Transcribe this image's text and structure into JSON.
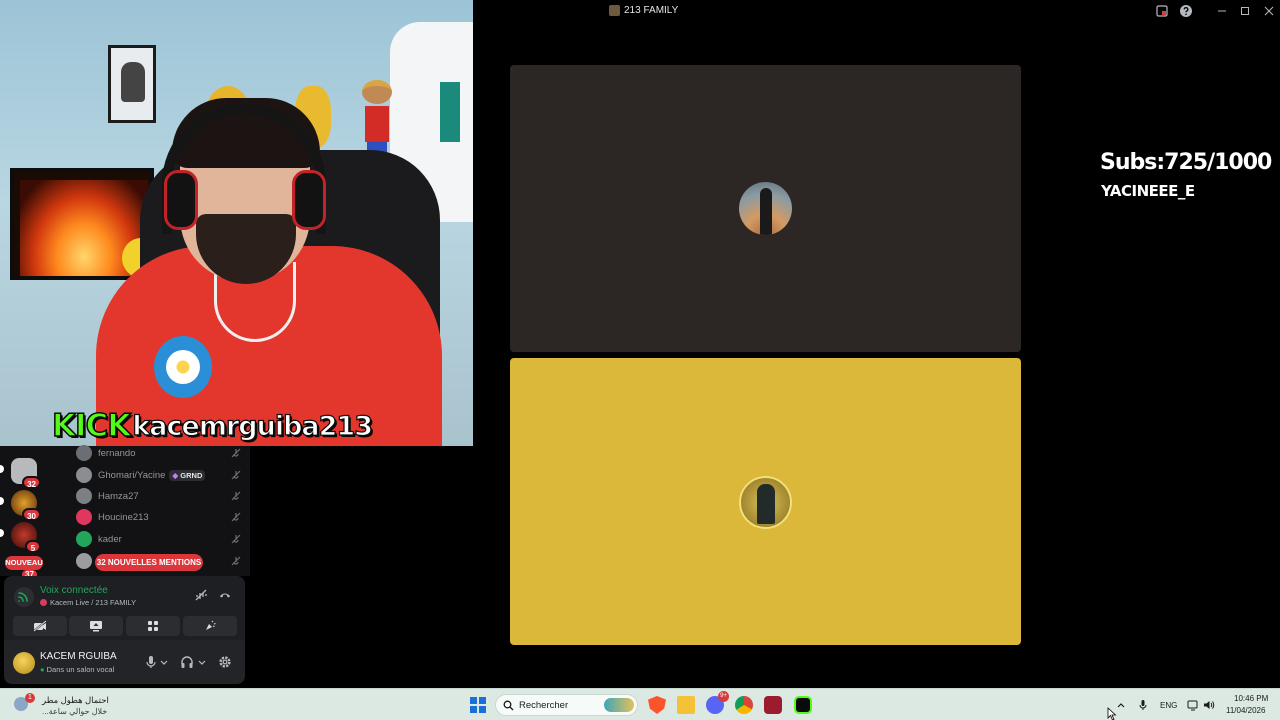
{
  "stream_overlay": {
    "kick_word": "KICK",
    "kick_username": "kacemrguiba213",
    "subs_text": "Subs:725/1000",
    "subs_username": "YACINEEE_E"
  },
  "guild_sidebar": {
    "items": [
      {
        "badge": "32"
      },
      {
        "badge": "30"
      },
      {
        "badge": "5"
      }
    ],
    "new_pill": "NOUVEAU",
    "new_count": "37"
  },
  "voice_members": [
    {
      "name": "fernando",
      "avatar_color": "#6b6f75"
    },
    {
      "name": "Ghomari/Yacine",
      "tag": "GRND",
      "avatar_color": "#8a8d91"
    },
    {
      "name": "Hamza27",
      "avatar_color": "#7c7f84"
    },
    {
      "name": "Houcine213",
      "avatar_color": "#e0375e"
    },
    {
      "name": "kader",
      "avatar_color": "#23a55a"
    }
  ],
  "mentions_pill": "32 NOUVELLES MENTIONS",
  "voice_panel": {
    "title": "Voix connectée",
    "subtitle": "Kacem Live / 213 FAMILY"
  },
  "user_panel": {
    "name": "KACEM RGUIBA",
    "status": "Dans un salon vocal"
  },
  "call_window": {
    "title": "213 FAMILY",
    "tile_colors": [
      "#2c2725",
      "#dbb73a"
    ]
  },
  "taskbar": {
    "weather_line1": "احتمال هطول مطر",
    "weather_line2": "خلال حوالي ساعة...",
    "weather_badge": "1",
    "search_placeholder": "Rechercher",
    "discord_badge": "9+",
    "language": "ENG",
    "time": "10:46 PM",
    "date": "11/04/2026"
  }
}
